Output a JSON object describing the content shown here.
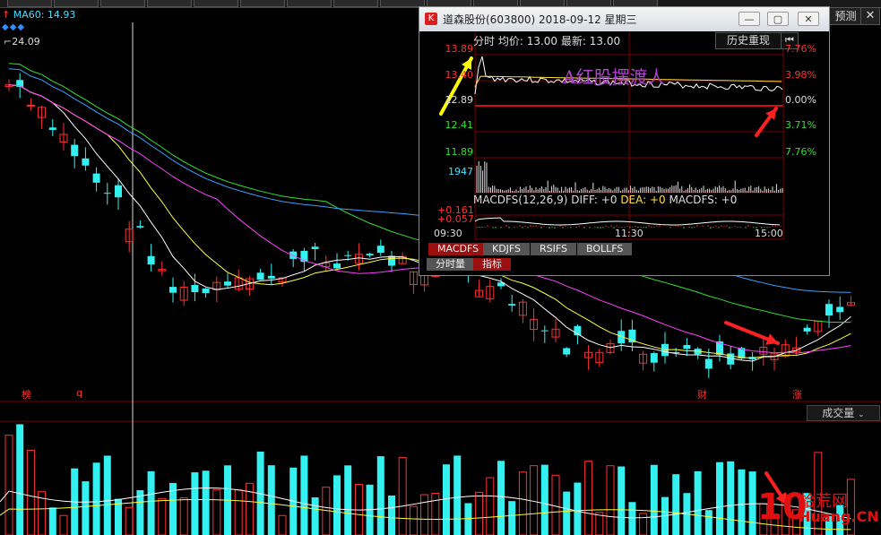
{
  "toolbar": {
    "tabs": [
      "",
      "",
      "",
      "",
      "",
      "",
      "",
      "",
      "",
      "",
      "",
      "",
      "",
      ""
    ]
  },
  "main_chart": {
    "ma60_label": "MA60: 14.93",
    "ma60_arrow": "↑",
    "diamonds": "◆◆◆",
    "low_price_label": "24.09",
    "markers": [
      {
        "text": "榜"
      },
      {
        "text": "q"
      },
      {
        "text": "财"
      },
      {
        "text": "涨"
      }
    ],
    "candle_up_color": "#ff3030",
    "candle_down_color": "#34f0f0"
  },
  "right_buttons": {
    "predict_label": "预测",
    "close_label": "✕"
  },
  "volume_panel": {
    "selector_label": "成交量",
    "selector_chevron": "⌄"
  },
  "popup": {
    "title": "道森股份(603800) 2018-09-12 星期三",
    "logo_glyph": "K",
    "win_min": "—",
    "win_max": "▢",
    "win_close": "✕",
    "header": {
      "mode_label": "分时",
      "avg_label": "均价: 13.00",
      "latest_label": "最新: 13.00"
    },
    "history_button": "历史重现",
    "history_back": "⏮",
    "price_left": [
      {
        "text": "13.89",
        "color": "#ff3030"
      },
      {
        "text": "13.40",
        "color": "#ff3030"
      },
      {
        "text": "12.89",
        "color": "#dddddd"
      },
      {
        "text": "12.41",
        "color": "#30e030"
      },
      {
        "text": "11.89",
        "color": "#30e030"
      }
    ],
    "pct_right": [
      {
        "text": "7.76%",
        "color": "#ff3030"
      },
      {
        "text": "3.98%",
        "color": "#ff3030"
      },
      {
        "text": "0.00%",
        "color": "#dddddd"
      },
      {
        "text": "3.71%",
        "color": "#30e030"
      },
      {
        "text": "7.76%",
        "color": "#30e030"
      }
    ],
    "volume_label": "1947",
    "watermark": "A红股摆渡人",
    "macd": {
      "name": "MACDFS(12,26,9)",
      "diff": "DIFF: +0",
      "dea": "DEA: +0",
      "macdfs": "MACDFS: +0",
      "top_value": "+0.161",
      "bottom_value": "+0.057"
    },
    "times": [
      "09:30",
      "11:30",
      "15:00"
    ],
    "indicator_tabs": [
      "MACDFS",
      "KDJFS",
      "RSIFS",
      "BOLLFS"
    ],
    "sub_tabs": [
      "分时量",
      "指标"
    ]
  },
  "site_logo": {
    "big": "10",
    "cn": "拾荒网",
    "url": "Huang.CN"
  }
}
